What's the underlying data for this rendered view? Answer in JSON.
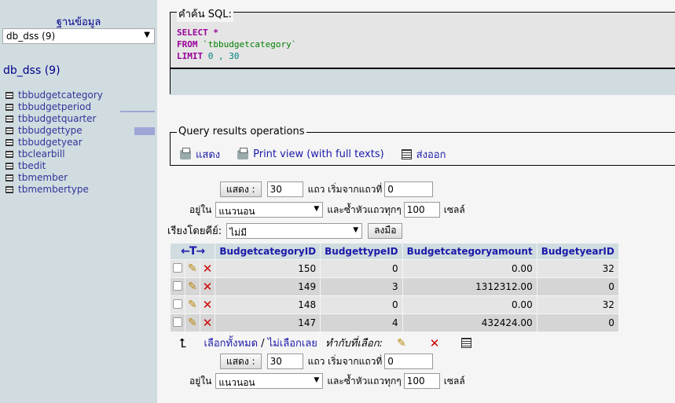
{
  "nav": {
    "heading": "ฐานข้อมูล",
    "db_selected": "db_dss (9)",
    "db_title": "db_dss (9)",
    "tables": [
      "tbbudgetcategory",
      "tbbudgetperiod",
      "tbbudgetquarter",
      "tbbudgettype",
      "tbbudgetyear",
      "tbclearbill",
      "tbedit",
      "tbmember",
      "tbmembertype"
    ]
  },
  "sql": {
    "legend": "คำค้น SQL:",
    "kw_select": "SELECT",
    "star": " *",
    "kw_from": "FROM",
    "table": " `tbbudgetcategory`",
    "kw_limit": "LIMIT",
    "limit_vals": " 0 , 30"
  },
  "qro": {
    "legend": "Query results operations",
    "show": "แสดง",
    "print_view": "Print view (with full texts)",
    "export": "ส่งออก"
  },
  "nav_form": {
    "show_btn": "แสดง :",
    "rows": "30",
    "rows_label": "แถว เริ่มจากแถวที่",
    "start": "0",
    "in_label": "อยู่ใน",
    "mode": "แนวนอน",
    "repeat_label": "และซ้ำหัวแถวทุกๆ",
    "repeat": "100",
    "cells_label": "เซลล์"
  },
  "sort": {
    "label": "เรียงโดยคีย์:",
    "value": "ไม่มี",
    "go": "ลงมือ"
  },
  "table": {
    "columns": [
      "BudgetcategoryID",
      "BudgettypeID",
      "Budgetcategoryamount",
      "BudgetyearID"
    ],
    "rows": [
      [
        "150",
        "0",
        "0.00",
        "32"
      ],
      [
        "149",
        "3",
        "1312312.00",
        "0"
      ],
      [
        "148",
        "0",
        "0.00",
        "32"
      ],
      [
        "147",
        "4",
        "432424.00",
        "0"
      ]
    ]
  },
  "bulk": {
    "check_all": "เลือกทั้งหมด",
    "sep": " / ",
    "uncheck_all": "ไม่เลือกเลย",
    "with_selected": "ทำกับที่เลือก:"
  }
}
